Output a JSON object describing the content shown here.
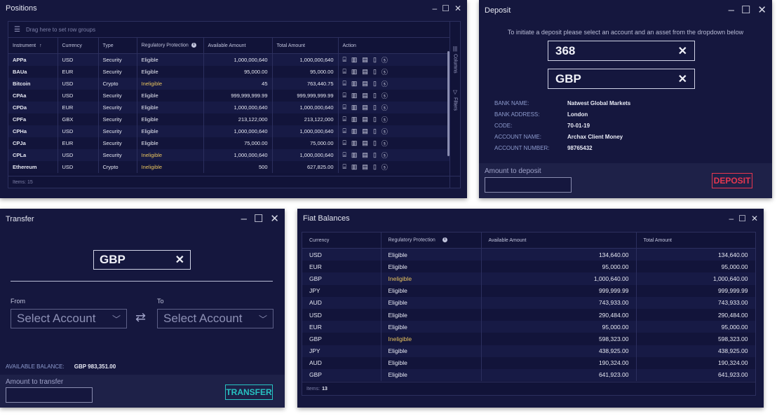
{
  "positions": {
    "title": "Positions",
    "group_hint": "Drag here to set row groups",
    "columns": [
      "Instrument",
      "Currency",
      "Type",
      "Regulatory Protection",
      "Available Amount",
      "Total Amount",
      "Action"
    ],
    "sort_indicator": "↑",
    "side_tabs": {
      "columns": "Columns",
      "filters": "Filters"
    },
    "rows": [
      {
        "instrument": "APPa",
        "currency": "USD",
        "type": "Security",
        "protection": "Eligible",
        "available": "1,000,000,640",
        "total": "1,000,000,640"
      },
      {
        "instrument": "BAUa",
        "currency": "EUR",
        "type": "Security",
        "protection": "Eligible",
        "available": "95,000.00",
        "total": "95,000.00"
      },
      {
        "instrument": "Bitcoin",
        "currency": "USD",
        "type": "Crypto",
        "protection": "Ineligible",
        "available": "45",
        "total": "763,440.75"
      },
      {
        "instrument": "CPAa",
        "currency": "USD",
        "type": "Security",
        "protection": "Eligible",
        "available": "999,999,999.99",
        "total": "999,999,999.99"
      },
      {
        "instrument": "CPDa",
        "currency": "EUR",
        "type": "Security",
        "protection": "Eligible",
        "available": "1,000,000,640",
        "total": "1,000,000,640"
      },
      {
        "instrument": "CPFa",
        "currency": "GBX",
        "type": "Security",
        "protection": "Eligible",
        "available": "213,122,000",
        "total": "213,122,000"
      },
      {
        "instrument": "CPHa",
        "currency": "USD",
        "type": "Security",
        "protection": "Eligible",
        "available": "1,000,000,640",
        "total": "1,000,000,640"
      },
      {
        "instrument": "CPJa",
        "currency": "EUR",
        "type": "Security",
        "protection": "Eligible",
        "available": "75,000.00",
        "total": "75,000.00"
      },
      {
        "instrument": "CPLa",
        "currency": "USD",
        "type": "Security",
        "protection": "Ineligible",
        "available": "1,000,000,640",
        "total": "1,000,000,640"
      },
      {
        "instrument": "Ethereum",
        "currency": "USD",
        "type": "Crypto",
        "protection": "Ineligible",
        "available": "500",
        "total": "627,825.00"
      }
    ],
    "action_icons": [
      "ticket-icon",
      "bar-chart-icon",
      "clipboard-icon",
      "tablet-icon",
      "dollar-coin-icon"
    ],
    "footer": "Items: 15"
  },
  "deposit": {
    "title": "Deposit",
    "instruction": "To initiate a deposit please select an account and an asset from the dropdown below",
    "account_value": "368",
    "asset_value": "GBP",
    "bank_info": [
      {
        "key": "BANK NAME:",
        "value": "Natwest Global Markets"
      },
      {
        "key": "BANK ADDRESS:",
        "value": "London"
      },
      {
        "key": "CODE:",
        "value": "70-01-19"
      },
      {
        "key": "ACCOUNT NAME:",
        "value": "Archax Client Money"
      },
      {
        "key": "ACCOUNT NUMBER:",
        "value": "98765432"
      }
    ],
    "amount_label": "Amount to deposit",
    "amount_value": "",
    "button": "DEPOSIT",
    "button_color": "#e8364f"
  },
  "transfer": {
    "title": "Transfer",
    "asset_value": "GBP",
    "from_label": "From",
    "to_label": "To",
    "from_placeholder": "Select Account",
    "to_placeholder": "Select Account",
    "balance_key": "AVAILABLE BALANCE:",
    "balance_value": "GBP 983,351.00",
    "amount_label": "Amount to transfer",
    "amount_value": "",
    "button": "TRANSFER",
    "button_color": "#27c2c2"
  },
  "fiat": {
    "title": "Fiat Balances",
    "columns": [
      "Currency",
      "Regulatory Protection",
      "Available Amount",
      "Total Amount"
    ],
    "rows": [
      {
        "currency": "USD",
        "protection": "Eligible",
        "available": "134,640.00",
        "total": "134,640.00"
      },
      {
        "currency": "EUR",
        "protection": "Eligible",
        "available": "95,000.00",
        "total": "95,000.00"
      },
      {
        "currency": "GBP",
        "protection": "Ineligible",
        "available": "1,000,640.00",
        "total": "1,000,640.00"
      },
      {
        "currency": "JPY",
        "protection": "Eligible",
        "available": "999,999.99",
        "total": "999,999.99"
      },
      {
        "currency": "AUD",
        "protection": "Eligible",
        "available": "743,933.00",
        "total": "743,933.00"
      },
      {
        "currency": "USD",
        "protection": "Eligible",
        "available": "290,484.00",
        "total": "290,484.00"
      },
      {
        "currency": "EUR",
        "protection": "Eligible",
        "available": "95,000.00",
        "total": "95,000.00"
      },
      {
        "currency": "GBP",
        "protection": "Ineligible",
        "available": "598,323.00",
        "total": "598,323.00"
      },
      {
        "currency": "JPY",
        "protection": "Eligible",
        "available": "438,925.00",
        "total": "438,925.00"
      },
      {
        "currency": "AUD",
        "protection": "Eligible",
        "available": "190,324.00",
        "total": "190,324.00"
      },
      {
        "currency": "GBP",
        "protection": "Eligible",
        "available": "641,923.00",
        "total": "641,923.00"
      }
    ],
    "footer_label": "Items:",
    "footer_count": "13"
  },
  "colors": {
    "window_bg": "#15173e",
    "ineligible": "#e8c35e",
    "info_label": "#8e9ccf"
  }
}
